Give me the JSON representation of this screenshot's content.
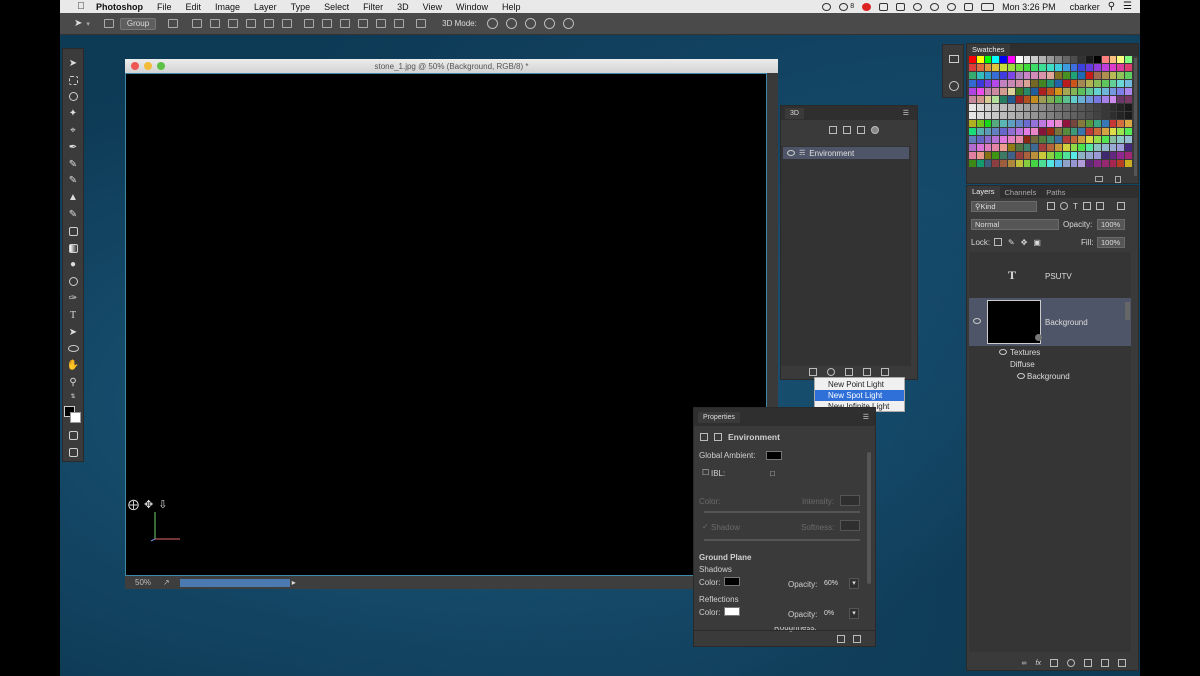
{
  "menubar": {
    "apple": "",
    "app_name": "Photoshop",
    "menus": [
      "File",
      "Edit",
      "Image",
      "Layer",
      "Type",
      "Select",
      "Filter",
      "3D",
      "View",
      "Window",
      "Help"
    ],
    "badge_count": "8",
    "clock": "Mon 3:26 PM",
    "user": "cbarker"
  },
  "options_bar": {
    "group_select": "Group",
    "mode_label": "3D Mode:"
  },
  "document": {
    "title": "stone_1.jpg @ 50% (Background, RGB/8) *",
    "zoom": "50%"
  },
  "panel_3d": {
    "tab": "3D",
    "scene_item": "Environment"
  },
  "light_menu": {
    "items": [
      "New Point Light",
      "New Spot Light",
      "New Infinite Light"
    ],
    "highlighted_index": 1
  },
  "properties": {
    "tab": "Properties",
    "header": "Environment",
    "global_ambient_label": "Global Ambient:",
    "ibl_label": "IBL:",
    "color_label": "Color:",
    "intensity_label": "Intensity:",
    "shadow_label": "Shadow",
    "softness_label": "Softness:",
    "ground_plane": "Ground Plane",
    "shadows": "Shadows",
    "shadows_color_label": "Color:",
    "shadows_opacity_label": "Opacity:",
    "shadows_opacity": "60%",
    "reflections": "Reflections",
    "reflections_color_label": "Color:",
    "reflections_opacity_label": "Opacity:",
    "reflections_opacity": "0%",
    "roughness_label": "Roughness:"
  },
  "swatches": {
    "tab": "Swatches"
  },
  "layers": {
    "tabs": [
      "Layers",
      "Channels",
      "Paths"
    ],
    "filter": "Kind",
    "blend_mode": "Normal",
    "opacity_label": "Opacity:",
    "opacity": "100%",
    "lock_label": "Lock:",
    "fill_label": "Fill:",
    "fill": "100%",
    "text_layer": "PSUTV",
    "bg_layer": "Background",
    "textures": "Textures",
    "diffuse": "Diffuse",
    "diffuse_item": "Background"
  },
  "colors": {
    "menubar_bg": "#e9e9e9",
    "panel_bg": "#3a3a3a",
    "highlight": "#2e6fd8",
    "canvas_border": "#3d8aa8"
  }
}
